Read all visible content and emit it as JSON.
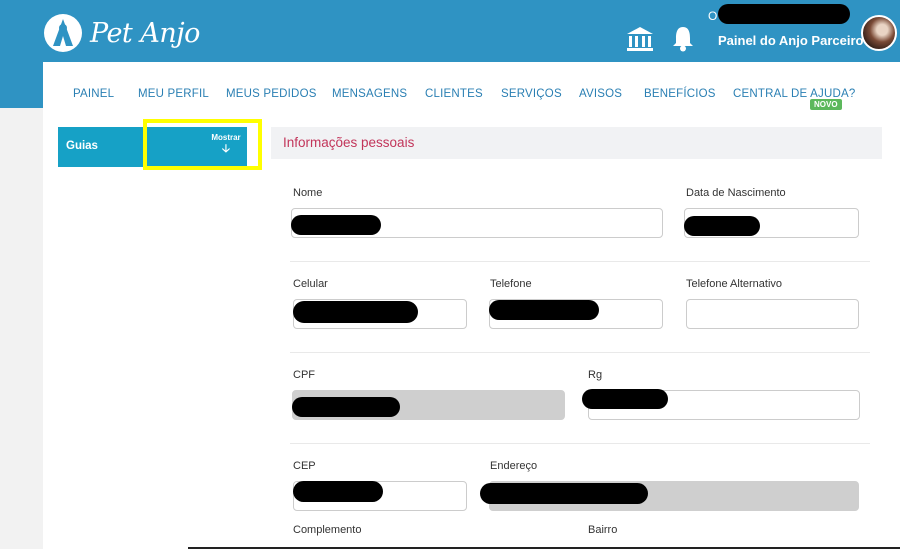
{
  "brand": {
    "name": "Pet Anjo"
  },
  "header": {
    "greeting": "O",
    "partner_menu": "Painel do Anjo Parceiro",
    "partner_menu_caret": "▾",
    "icons": [
      "bank-icon",
      "bell-icon",
      "avatar"
    ]
  },
  "nav": {
    "items": [
      "PAINEL",
      "MEU PERFIL",
      "MEUS PEDIDOS",
      "MENSAGENS",
      "CLIENTES",
      "SERVIÇOS",
      "AVISOS",
      "BENEFÍCIOS",
      "CENTRAL DE AJUDA?"
    ],
    "badge": "NOVO"
  },
  "sidebar": {
    "title": "Guias",
    "show_label": "Mostrar",
    "show_icon": "arrow-down-icon",
    "show_arrow": "🡣"
  },
  "section": {
    "title": "Informações pessoais"
  },
  "form": {
    "labels": {
      "nome": "Nome",
      "nascimento": "Data de Nascimento",
      "celular": "Celular",
      "telefone": "Telefone",
      "telefone_alt": "Telefone Alternativo",
      "cpf": "CPF",
      "rg": "Rg",
      "cep": "CEP",
      "endereco": "Endereço",
      "complemento": "Complemento",
      "bairro": "Bairro"
    }
  },
  "colors": {
    "header_bg": "#2f93c3",
    "nav_link": "#2a7fb3",
    "section_title": "#c2355a",
    "guides_bg": "#16a1c6",
    "badge_bg": "#5cb85c",
    "highlight": "#ffff00"
  }
}
